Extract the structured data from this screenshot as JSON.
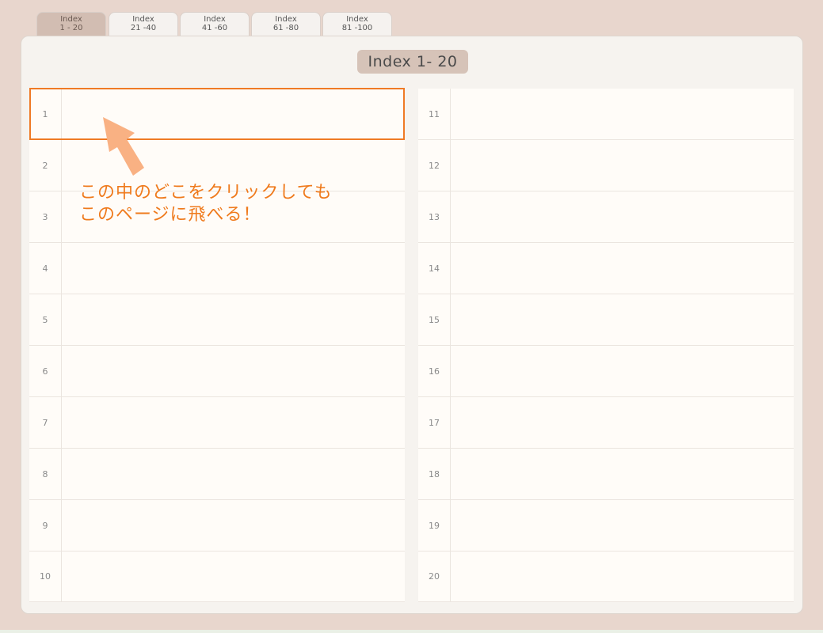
{
  "tabs": [
    {
      "line1": "Index",
      "line2": "1 - 20",
      "active": true
    },
    {
      "line1": "Index",
      "line2": "21 -40",
      "active": false
    },
    {
      "line1": "Index",
      "line2": "41 -60",
      "active": false
    },
    {
      "line1": "Index",
      "line2": "61 -80",
      "active": false
    },
    {
      "line1": "Index",
      "line2": "81 -100",
      "active": false
    }
  ],
  "page_title": "Index 1- 20",
  "left_rows": [
    "1",
    "2",
    "3",
    "4",
    "5",
    "6",
    "7",
    "8",
    "9",
    "10"
  ],
  "right_rows": [
    "11",
    "12",
    "13",
    "14",
    "15",
    "16",
    "17",
    "18",
    "19",
    "20"
  ],
  "annotation": {
    "line1": "この中のどこをクリックしても",
    "line2": "このページに飛べる！",
    "color": "#ef7a1c"
  },
  "colors": {
    "background": "#e8d6cd",
    "active_tab": "#d2bdb2",
    "highlight": "#ef7a25",
    "arrow": "#f9b183"
  },
  "icons": {
    "arrow": "pointer-arrow-icon"
  }
}
